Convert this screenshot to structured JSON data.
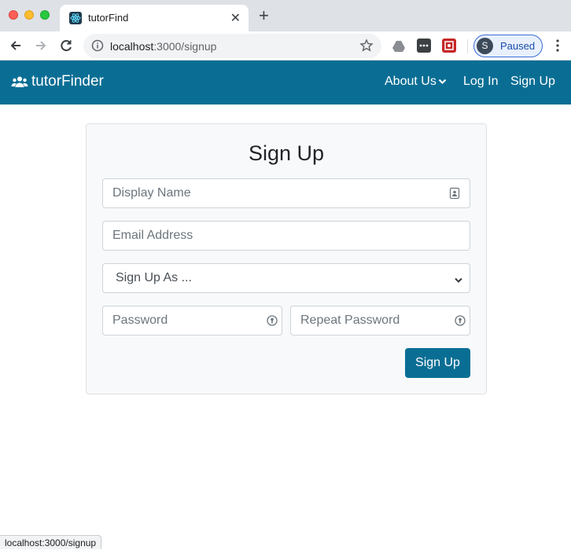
{
  "browser": {
    "tab_title": "tutorFind",
    "url_host": "localhost",
    "url_path": ":3000/signup",
    "profile_initial": "S",
    "profile_status": "Paused",
    "status_bar_url": "localhost:3000/signup"
  },
  "navbar": {
    "brand": "tutorFinder",
    "brand_icon": "users-icon",
    "links": [
      {
        "label": "About Us",
        "has_dropdown": true
      },
      {
        "label": "Log In"
      },
      {
        "label": "Sign Up"
      }
    ],
    "color": "#0a6e94"
  },
  "form": {
    "title": "Sign Up",
    "display_name_placeholder": "Display Name",
    "email_placeholder": "Email Address",
    "signup_as_selected": "Sign Up As ...",
    "password_placeholder": "Password",
    "repeat_password_placeholder": "Repeat Password",
    "submit_label": "Sign Up"
  }
}
